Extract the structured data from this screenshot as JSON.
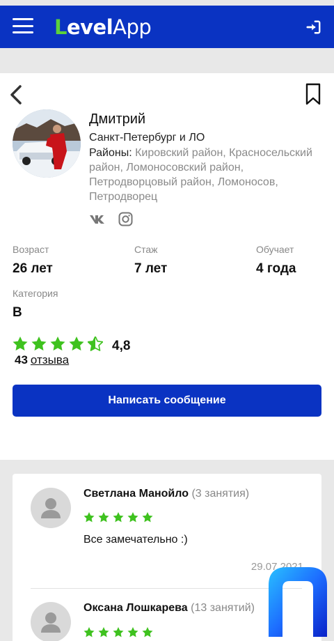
{
  "header": {
    "logo_first": "L",
    "logo_rest": "evel",
    "logo_app": "App",
    "menu_icon": "hamburger-icon",
    "login_icon": "sign-in-icon"
  },
  "profile": {
    "name": "Дмитрий",
    "city": "Санкт-Петербург и ЛО",
    "districts_label": "Районы:",
    "districts": "Кировский район, Красносельский район, Ломоносовский район, Петродворцовый район, Ломоносов, Петродворец",
    "social": [
      "vk-icon",
      "instagram-icon"
    ],
    "stats": {
      "age_label": "Возраст",
      "age_value": "26 лет",
      "experience_label": "Стаж",
      "experience_value": "7 лет",
      "teaching_label": "Обучает",
      "teaching_value": "4 года",
      "category_label": "Категория",
      "category_value": "B"
    },
    "rating": {
      "value": "4,8",
      "stars": 4.5,
      "reviews_count": "43",
      "reviews_label": "отзыва"
    },
    "message_button": "Написать сообщение"
  },
  "reviews": [
    {
      "name": "Светлана Манойло",
      "lessons": "(3 занятия)",
      "stars": 5,
      "text": "Все замечательно :)",
      "date": "29.07.2021"
    },
    {
      "name": "Оксана Лошкарева",
      "lessons": "(13 занятий)",
      "stars": 5,
      "text": "",
      "date": ""
    }
  ],
  "colors": {
    "brand_blue": "#0a33c2",
    "star_green": "#3fc21f",
    "logo_green": "#5cd13b"
  }
}
